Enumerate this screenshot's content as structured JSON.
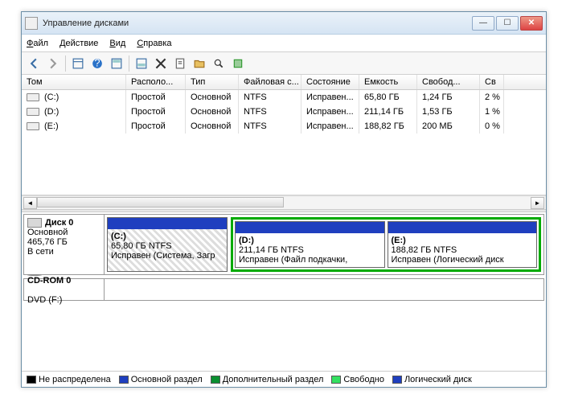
{
  "window": {
    "title": "Управление дисками"
  },
  "menu": {
    "file": "Файл",
    "action": "Действие",
    "view": "Вид",
    "help": "Справка"
  },
  "columns": {
    "volume": "Том",
    "layout": "Располо...",
    "type": "Тип",
    "fs": "Файловая с...",
    "status": "Состояние",
    "capacity": "Емкость",
    "free": "Свобод...",
    "pct": "Св"
  },
  "volumes": [
    {
      "name": "(C:)",
      "layout": "Простой",
      "type": "Основной",
      "fs": "NTFS",
      "status": "Исправен...",
      "capacity": "65,80 ГБ",
      "free": "1,24 ГБ",
      "pct": "2 %"
    },
    {
      "name": "(D:)",
      "layout": "Простой",
      "type": "Основной",
      "fs": "NTFS",
      "status": "Исправен...",
      "capacity": "211,14 ГБ",
      "free": "1,53 ГБ",
      "pct": "1 %"
    },
    {
      "name": "(E:)",
      "layout": "Простой",
      "type": "Основной",
      "fs": "NTFS",
      "status": "Исправен...",
      "capacity": "188,82 ГБ",
      "free": "200 МБ",
      "pct": "0 %"
    }
  ],
  "disk0": {
    "label": "Диск 0",
    "type": "Основной",
    "size": "465,76 ГБ",
    "state": "В сети",
    "partitions": [
      {
        "name": "(C:)",
        "info": "65,80 ГБ NTFS",
        "status": "Исправен (Система, Загр"
      },
      {
        "name": "(D:)",
        "info": "211,14 ГБ NTFS",
        "status": "Исправен (Файл подкачки,"
      },
      {
        "name": "(E:)",
        "info": "188,82 ГБ NTFS",
        "status": "Исправен (Логический диск"
      }
    ]
  },
  "cdrom": {
    "label": "CD-ROM 0",
    "sub": "DVD (F:)"
  },
  "legend": {
    "unalloc": "Не распределена",
    "primary": "Основной раздел",
    "extended": "Дополнительный раздел",
    "free": "Свободно",
    "logical": "Логический диск"
  },
  "legend_colors": {
    "unalloc": "#000",
    "primary": "#1f3fbf",
    "extended": "#0a8f30",
    "free": "#33e060",
    "logical": "#1f3fbf"
  }
}
